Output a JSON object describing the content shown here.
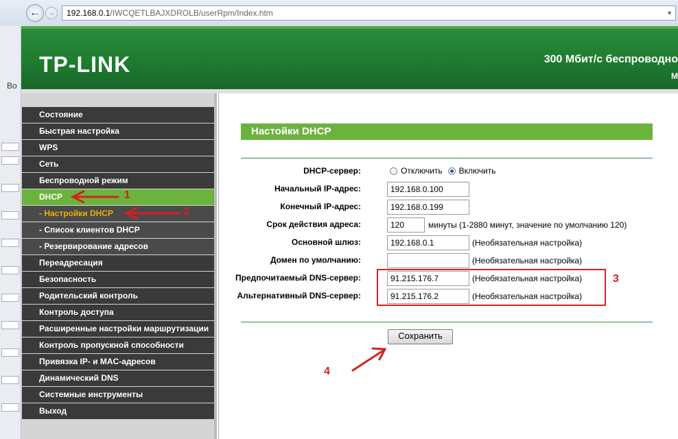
{
  "browser": {
    "url_host": "192.168.0.1",
    "url_path": "/IWCQETLBAJXDROLB/userRpm/Index.htm",
    "back_icon": "back-arrow-icon",
    "left_strip_letter": "Во"
  },
  "header": {
    "logo": "TP-LINK",
    "title": "300 Мбит/с беспроводно",
    "subtitle": "М"
  },
  "sidebar": {
    "items": [
      {
        "label": "Состояние"
      },
      {
        "label": "Быстрая настройка"
      },
      {
        "label": "WPS"
      },
      {
        "label": "Сеть"
      },
      {
        "label": "Беспроводной режим"
      },
      {
        "label": "DHCP"
      },
      {
        "label": "- Настройки DHCP"
      },
      {
        "label": "- Список клиентов DHCP"
      },
      {
        "label": "- Резервирование адресов"
      },
      {
        "label": "Переадресация"
      },
      {
        "label": "Безопасность"
      },
      {
        "label": "Родительский контроль"
      },
      {
        "label": "Контроль доступа"
      },
      {
        "label": "Расширенные настройки маршрутизации"
      },
      {
        "label": "Контроль пропускной способности"
      },
      {
        "label": "Привязка IP- и MAC-адресов"
      },
      {
        "label": "Динамический DNS"
      },
      {
        "label": "Системные инструменты"
      },
      {
        "label": "Выход"
      }
    ]
  },
  "panel": {
    "title": "Настойки DHCP",
    "dhcp_server_label": "DHCP-сервер:",
    "radio_disable": "Отключить",
    "radio_enable": "Включить",
    "start_ip_label": "Начальный IP-адрес:",
    "start_ip_value": "192.168.0.100",
    "end_ip_label": "Конечный IP-адрес:",
    "end_ip_value": "192.168.0.199",
    "lease_label": "Срок действия адреса:",
    "lease_value": "120",
    "lease_note": "минуты (1-2880 минут, значение по умолчанию 120)",
    "gateway_label": "Основной шлюз:",
    "gateway_value": "192.168.0.1",
    "domain_label": "Домен по умолчанию:",
    "domain_value": "",
    "dns1_label": "Предпочитаемый DNS-сервер:",
    "dns1_value": "91.215.176.7",
    "dns2_label": "Альтернативный DNS-сервер:",
    "dns2_value": "91.215.176.2",
    "optional_note": "(Необязательная настройка)",
    "save_label": "Сохранить"
  },
  "annotations": {
    "n1": "1",
    "n2": "2",
    "n3": "3",
    "n4": "4",
    "color": "#d42020"
  },
  "colors": {
    "brand_green": "#6cb33e",
    "header_green": "#1d7a2e",
    "menu_dark": "#3a3a3a"
  }
}
